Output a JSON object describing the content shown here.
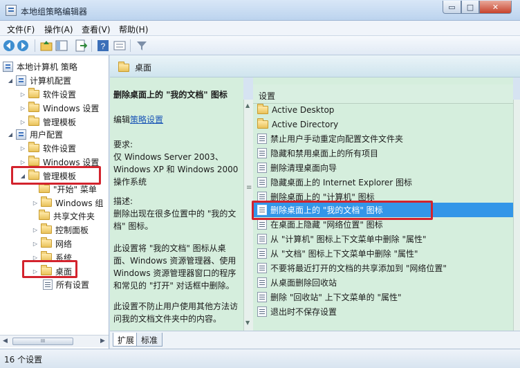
{
  "window": {
    "title": "本地组策略编辑器",
    "minimize_glyph": "▭",
    "maximize_glyph": "□",
    "close_glyph": "✕"
  },
  "menu": [
    "文件(F)",
    "操作(A)",
    "查看(V)",
    "帮助(H)"
  ],
  "toolbar_icons": [
    "back-arrow-icon",
    "forward-arrow-icon",
    "up-folder-icon",
    "show-hide-tree-icon",
    "export-list-icon",
    "help-icon",
    "properties-icon",
    "filter-icon"
  ],
  "tree": {
    "root": "本地计算机 策略",
    "computer_config": "计算机配置",
    "cc_software": "软件设置",
    "cc_windows": "Windows 设置",
    "cc_admin": "管理模板",
    "user_config": "用户配置",
    "uc_software": "软件设置",
    "uc_windows": "Windows 设置",
    "uc_admin": "管理模板",
    "start_menu": "\"开始\" 菜单",
    "windows_comp": "Windows 组",
    "shared_folders": "共享文件夹",
    "control_panel": "控制面板",
    "network": "网络",
    "system": "系统",
    "desktop": "桌面",
    "all_settings": "所有设置"
  },
  "header": {
    "title": "桌面"
  },
  "description": {
    "title": "删除桌面上的 \"我的文档\" 图标",
    "edit_prefix": "编辑",
    "edit_link": "策略设置",
    "requirements_label": "要求:",
    "requirements_text": "仅 Windows Server 2003、Windows XP 和 Windows 2000 操作系统",
    "desc_label": "描述:",
    "desc_text": "删除出现在很多位置中的 \"我的文档\" 图标。",
    "para1": "此设置将 \"我的文档\" 图标从桌面、Windows 资源管理器、使用 Windows 资源管理器窗口的程序和常见的 \"打开\" 对话框中删除。",
    "para2": "此设置不防止用户使用其他方法访问我的文档文件夹中的内容。"
  },
  "list": {
    "column_header": "设置",
    "items": [
      {
        "label": "Active Desktop",
        "kind": "folder"
      },
      {
        "label": "Active Directory",
        "kind": "folder"
      },
      {
        "label": "禁止用户手动重定向配置文件文件夹",
        "kind": "setting"
      },
      {
        "label": "隐藏和禁用桌面上的所有项目",
        "kind": "setting"
      },
      {
        "label": "删除清理桌面向导",
        "kind": "setting"
      },
      {
        "label": "隐藏桌面上的 Internet Explorer 图标",
        "kind": "setting"
      },
      {
        "label": "删除桌面上的 \"计算机\" 图标",
        "kind": "setting"
      },
      {
        "label": "删除桌面上的 \"我的文档\" 图标",
        "kind": "setting"
      },
      {
        "label": "在桌面上隐藏 \"网络位置\" 图标",
        "kind": "setting"
      },
      {
        "label": "从 \"计算机\" 图标上下文菜单中删除 \"属性\"",
        "kind": "setting"
      },
      {
        "label": "从 \"文档\" 图标上下文菜单中删除 \"属性\"",
        "kind": "setting"
      },
      {
        "label": "不要将最近打开的文档的共享添加到 \"网络位置\"",
        "kind": "setting"
      },
      {
        "label": "从桌面删除回收站",
        "kind": "setting"
      },
      {
        "label": "删除 \"回收站\" 上下文菜单的 \"属性\"",
        "kind": "setting"
      },
      {
        "label": "退出时不保存设置",
        "kind": "setting"
      }
    ]
  },
  "tabs": {
    "extended": "扩展",
    "standard": "标准"
  },
  "scroll_glyphs": {
    "left": "◀",
    "right": "▶",
    "up": "▲",
    "down": "▼",
    "thumb": "III",
    "grip": "≡"
  },
  "status": {
    "text": "16 个设置"
  },
  "highlight_color": "#d3232d",
  "selection_color": "#3396e8"
}
